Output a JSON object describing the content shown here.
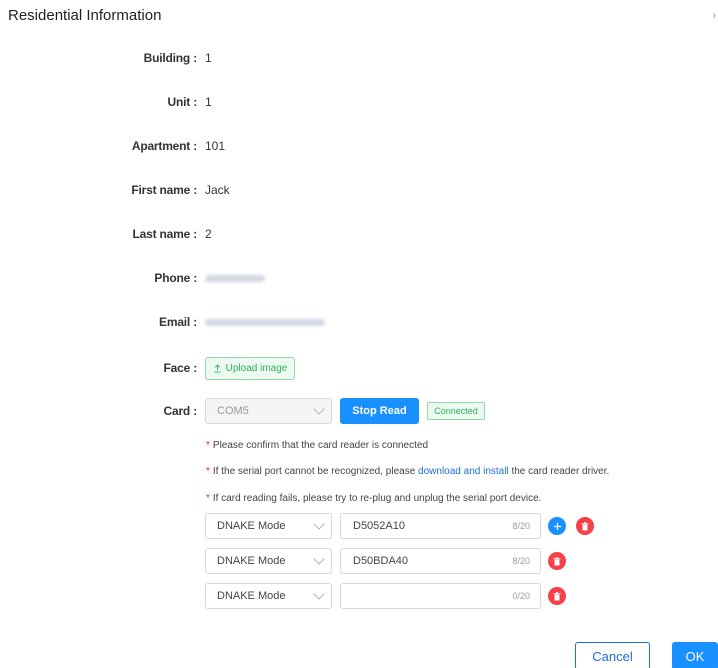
{
  "dialog": {
    "title": "Residential Information",
    "close_glyph": "›"
  },
  "fields": {
    "building": {
      "label": "Building :",
      "value": "1"
    },
    "unit": {
      "label": "Unit :",
      "value": "1"
    },
    "apartment": {
      "label": "Apartment :",
      "value": "101"
    },
    "first_name": {
      "label": "First name :",
      "value": "Jack"
    },
    "last_name": {
      "label": "Last name :",
      "value": "2"
    },
    "phone": {
      "label": "Phone :"
    },
    "email": {
      "label": "Email :"
    },
    "face": {
      "label": "Face :",
      "upload_label": "Upload image",
      "upload_icon": "upload-icon"
    },
    "card": {
      "label": "Card :",
      "port": "COM5",
      "stop_read_label": "Stop Read",
      "status": "Connected"
    }
  },
  "notes": [
    {
      "star": "*",
      "text": "Please confirm that the card reader is connected"
    },
    {
      "star": "*",
      "before": "If the serial port cannot be recognized, please ",
      "link": "download and install",
      "after": " the card reader driver."
    },
    {
      "star": "*",
      "text": "If card reading fails, please try to re-plug and unplug the serial port device."
    }
  ],
  "cards": [
    {
      "mode": "DNAKE Mode",
      "number": "D5052A10",
      "count": "8/20"
    },
    {
      "mode": "DNAKE Mode",
      "number": "D50BDA40",
      "count": "8/20"
    },
    {
      "mode": "DNAKE Mode",
      "number": "",
      "count": "0/20"
    }
  ],
  "footer": {
    "cancel_label": "Cancel",
    "ok_label": "OK"
  },
  "colors": {
    "primary": "#1890ff",
    "danger": "#f5404a",
    "success": "#2fb35c",
    "link": "#1e6fd9"
  }
}
